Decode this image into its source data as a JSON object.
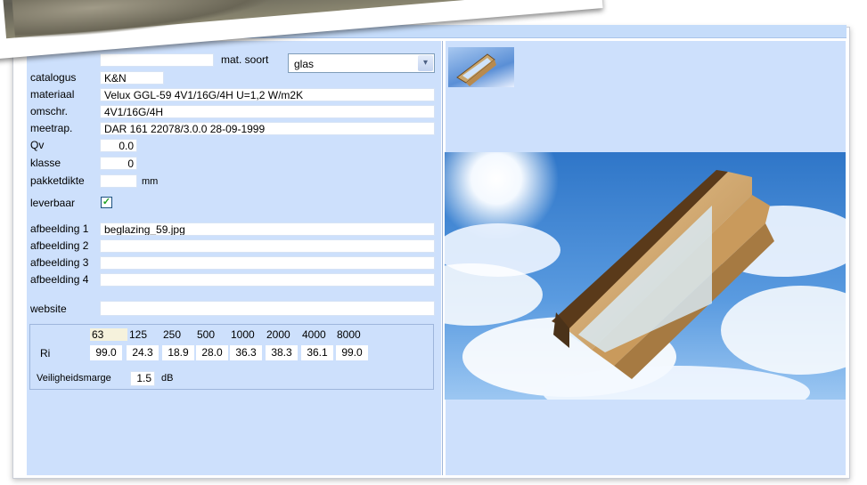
{
  "form": {
    "mat_soort_label": "mat. soort",
    "mat_soort_value": "glas",
    "catalogus_label": "catalogus",
    "catalogus_value": "K&N",
    "materiaal_label": "materiaal",
    "materiaal_value": "Velux GGL-59 4V1/16G/4H U=1,2 W/m2K",
    "omschr_label": "omschr.",
    "omschr_value": "4V1/16G/4H",
    "meetrap_label": "meetrap.",
    "meetrap_value": "DAR 161 22078/3.0.0 28-09-1999",
    "qv_label": "Qv",
    "qv_value": "0.0",
    "klasse_label": "klasse",
    "klasse_value": "0",
    "pakketdikte_label": "pakketdikte",
    "pakketdikte_value": "",
    "pakketdikte_unit": "mm",
    "leverbaar_label": "leverbaar",
    "leverbaar_checked": true,
    "leverbaar_mark": "✓",
    "afbeelding1_label": "afbeelding 1",
    "afbeelding1_value": "beglazing_59.jpg",
    "afbeelding2_label": "afbeelding 2",
    "afbeelding2_value": "",
    "afbeelding3_label": "afbeelding 3",
    "afbeelding3_value": "",
    "afbeelding4_label": "afbeelding 4",
    "afbeelding4_value": "",
    "website_label": "website",
    "website_value": ""
  },
  "acoustics": {
    "frequencies": [
      "63",
      "125",
      "250",
      "500",
      "1000",
      "2000",
      "4000",
      "8000"
    ],
    "ri_label": "Ri",
    "ri_values": [
      "99.0",
      "24.3",
      "18.9",
      "28.0",
      "36.3",
      "38.3",
      "36.1",
      "99.0"
    ],
    "veiligheidsmarge_label": "Veiligheidsmarge",
    "veiligheidsmarge_value": "1.5",
    "veiligheidsmarge_unit": "dB"
  },
  "images": {
    "thumbnail_icon": "window-thumbnail",
    "preview_icon": "roof-window-photo"
  },
  "colors": {
    "panel_bg": "#cde0fc",
    "topbar_bg": "#c5dcfa",
    "check_color": "#21a121"
  }
}
